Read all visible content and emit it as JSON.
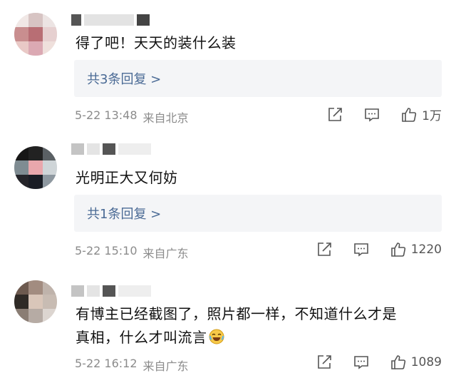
{
  "comments": [
    {
      "text": "得了吧！天天的装什么装",
      "replies": "共3条回复 >",
      "date": "5-22 13:48",
      "location": "来自北京",
      "likes": "1万"
    },
    {
      "text": "光明正大又何妨",
      "replies": "共1条回复 >",
      "date": "5-22 15:10",
      "location": "来自广东",
      "likes": "1220"
    },
    {
      "text_line1": "有博主已经截图了，照片都一样，不知道什么才是",
      "text_line2": "真相，什么才叫流言",
      "emoji": "crying-laughing-emoji",
      "date": "5-22 16:12",
      "location": "来自广东",
      "likes": "1089"
    }
  ],
  "colors": {
    "reply_link": "#4a6a95",
    "reply_bg": "#f4f5f7",
    "meta": "#8b8b8b",
    "text": "#111111"
  }
}
